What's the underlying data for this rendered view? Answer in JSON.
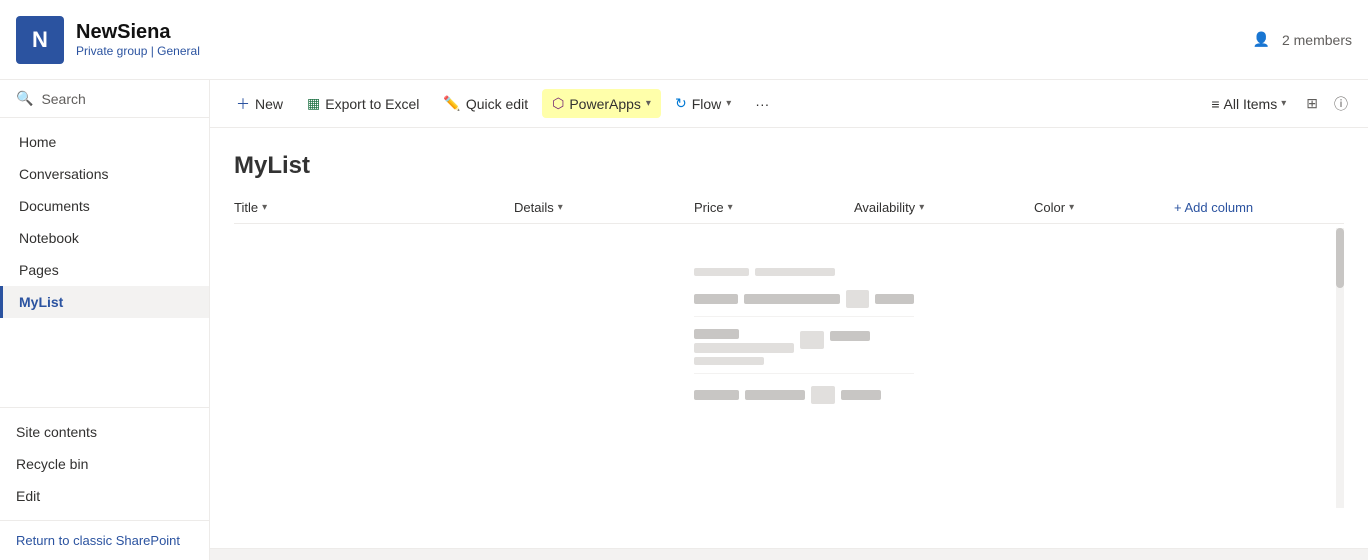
{
  "header": {
    "logo_letter": "N",
    "site_name": "NewSiena",
    "subtitle_prefix": "Private group | ",
    "subtitle_channel": "General",
    "members_label": "2 members"
  },
  "toolbar": {
    "new_label": "New",
    "export_label": "Export to Excel",
    "quickedit_label": "Quick edit",
    "powerapps_label": "PowerApps",
    "flow_label": "Flow",
    "more_label": "···",
    "allitems_label": "All Items",
    "filter_icon_title": "Filter",
    "info_icon_title": "Info"
  },
  "sidebar": {
    "search_label": "Search",
    "nav_items": [
      {
        "label": "Home",
        "active": false
      },
      {
        "label": "Conversations",
        "active": false
      },
      {
        "label": "Documents",
        "active": false
      },
      {
        "label": "Notebook",
        "active": false
      },
      {
        "label": "Pages",
        "active": false
      },
      {
        "label": "MyList",
        "active": true
      }
    ],
    "bottom_items": [
      {
        "label": "Site contents"
      },
      {
        "label": "Recycle bin"
      },
      {
        "label": "Edit"
      }
    ],
    "return_link": "Return to classic SharePoint"
  },
  "list": {
    "title": "MyList",
    "columns": [
      {
        "label": "Title"
      },
      {
        "label": "Details"
      },
      {
        "label": "Price"
      },
      {
        "label": "Availability"
      },
      {
        "label": "Color"
      }
    ],
    "add_column_label": "+ Add column"
  }
}
